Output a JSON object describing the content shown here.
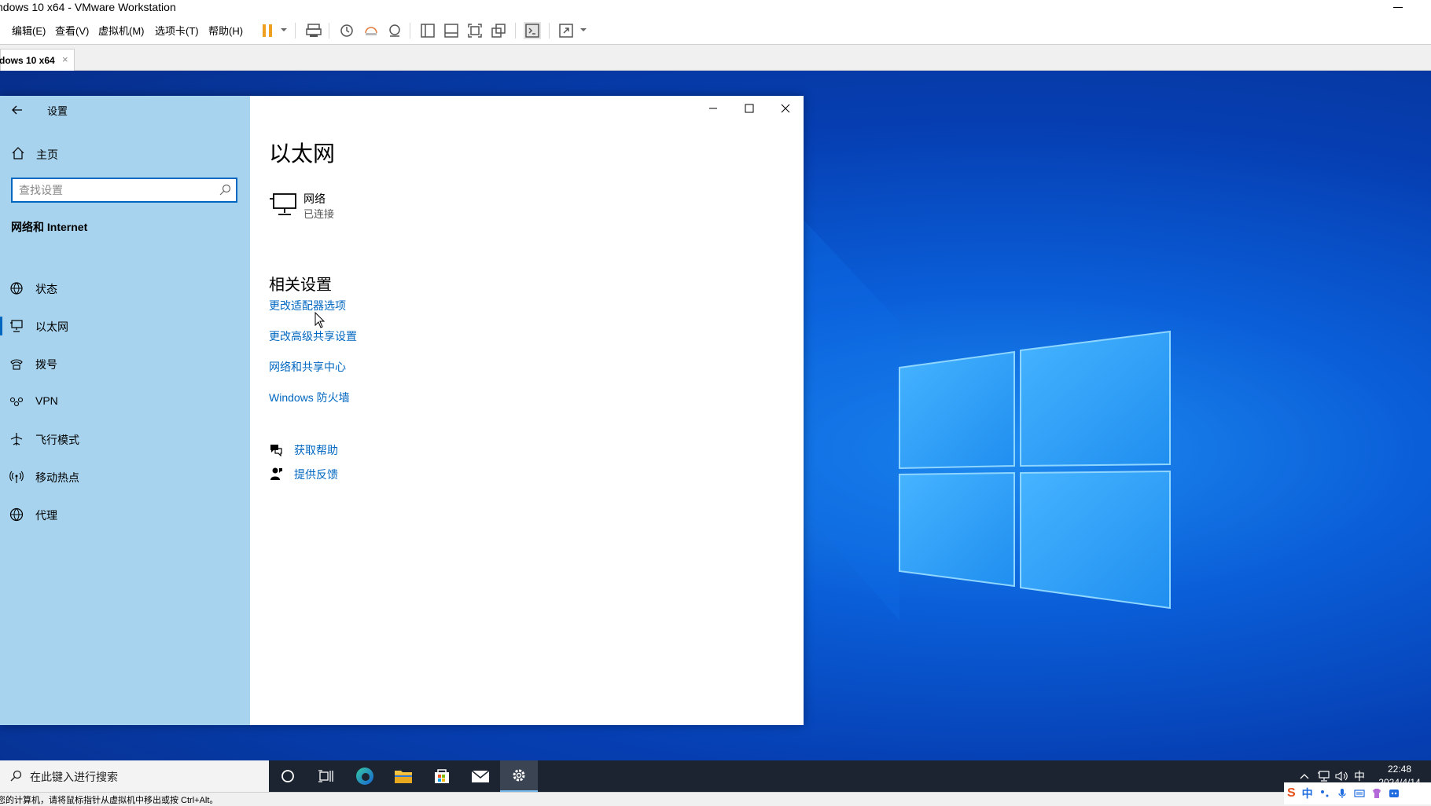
{
  "vm": {
    "window_title": "ndows 10 x64 - VMware Workstation",
    "menu": [
      "编辑(E)",
      "查看(V)",
      "虚拟机(M)",
      "选项卡(T)",
      "帮助(H)"
    ],
    "tab_label": "dows 10 x64",
    "tab_close": "×",
    "status_text": "您的计算机，请将鼠标指针从虚拟机中移出或按 Ctrl+Alt。"
  },
  "settings": {
    "title": "设置",
    "home": "主页",
    "search_placeholder": "查找设置",
    "section": "网络和 Internet",
    "nav_items": [
      "状态",
      "以太网",
      "拨号",
      "VPN",
      "飞行模式",
      "移动热点",
      "代理"
    ],
    "active_nav": "以太网",
    "page_title": "以太网",
    "network_name": "网络",
    "network_status": "已连接",
    "related_title": "相关设置",
    "links": [
      "更改适配器选项",
      "更改高级共享设置",
      "网络和共享中心",
      "Windows 防火墙"
    ],
    "help": "获取帮助",
    "feedback": "提供反馈"
  },
  "taskbar": {
    "search_placeholder": "在此键入进行搜索",
    "time": "22:48",
    "date": "2024/4/14",
    "ime_indicator": "中"
  },
  "ime_bar": {
    "logo": "S",
    "mode": "中"
  },
  "colors": {
    "accent": "#0067c0",
    "nav_bg": "#a7d3ee",
    "taskbar": "#1b2430",
    "pause": "#f0a020"
  }
}
